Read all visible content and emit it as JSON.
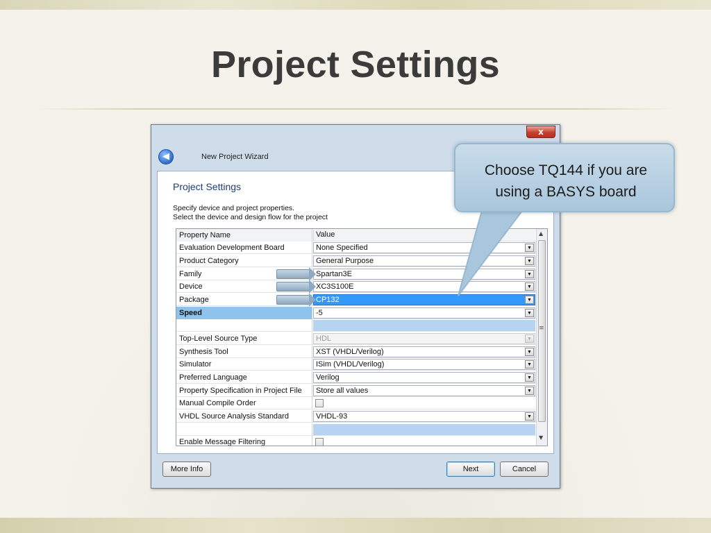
{
  "slide": {
    "title": "Project Settings"
  },
  "window": {
    "title": "New Project Wizard",
    "close_glyph": "x",
    "page_heading": "Project Settings",
    "description_line1": "Specify device and project properties.",
    "description_line2": "Select the device and design flow for the project"
  },
  "grid": {
    "header": {
      "name": "Property Name",
      "value": "Value"
    },
    "rows": [
      {
        "name": "Evaluation Development Board",
        "value": "None Specified"
      },
      {
        "name": "Product Category",
        "value": "General Purpose"
      },
      {
        "name": "Family",
        "value": "Spartan3E"
      },
      {
        "name": "Device",
        "value": "XC3S100E"
      },
      {
        "name": "Package",
        "value": "CP132"
      },
      {
        "name": "Speed",
        "value": "-5"
      },
      {
        "name": "",
        "value": ""
      },
      {
        "name": "Top-Level Source Type",
        "value": "HDL"
      },
      {
        "name": "Synthesis Tool",
        "value": "XST (VHDL/Verilog)"
      },
      {
        "name": "Simulator",
        "value": "ISim (VHDL/Verilog)"
      },
      {
        "name": "Preferred Language",
        "value": "Verilog"
      },
      {
        "name": "Property Specification in Project File",
        "value": "Store all values"
      },
      {
        "name": "Manual Compile Order",
        "value": ""
      },
      {
        "name": "VHDL Source Analysis Standard",
        "value": "VHDL-93"
      },
      {
        "name": "",
        "value": ""
      },
      {
        "name": "Enable Message Filtering",
        "value": ""
      }
    ]
  },
  "buttons": {
    "more_info": "More Info",
    "next": "Next",
    "cancel": "Cancel"
  },
  "callout": {
    "line1": "Choose  TQ144 if you are",
    "line2": "using a BASYS board"
  },
  "colors": {
    "selected_value": "#3399ff",
    "speed_highlight": "#8cc4ef",
    "callout_fill": "#b4cfe2",
    "title_text": "#3b3b3b"
  }
}
